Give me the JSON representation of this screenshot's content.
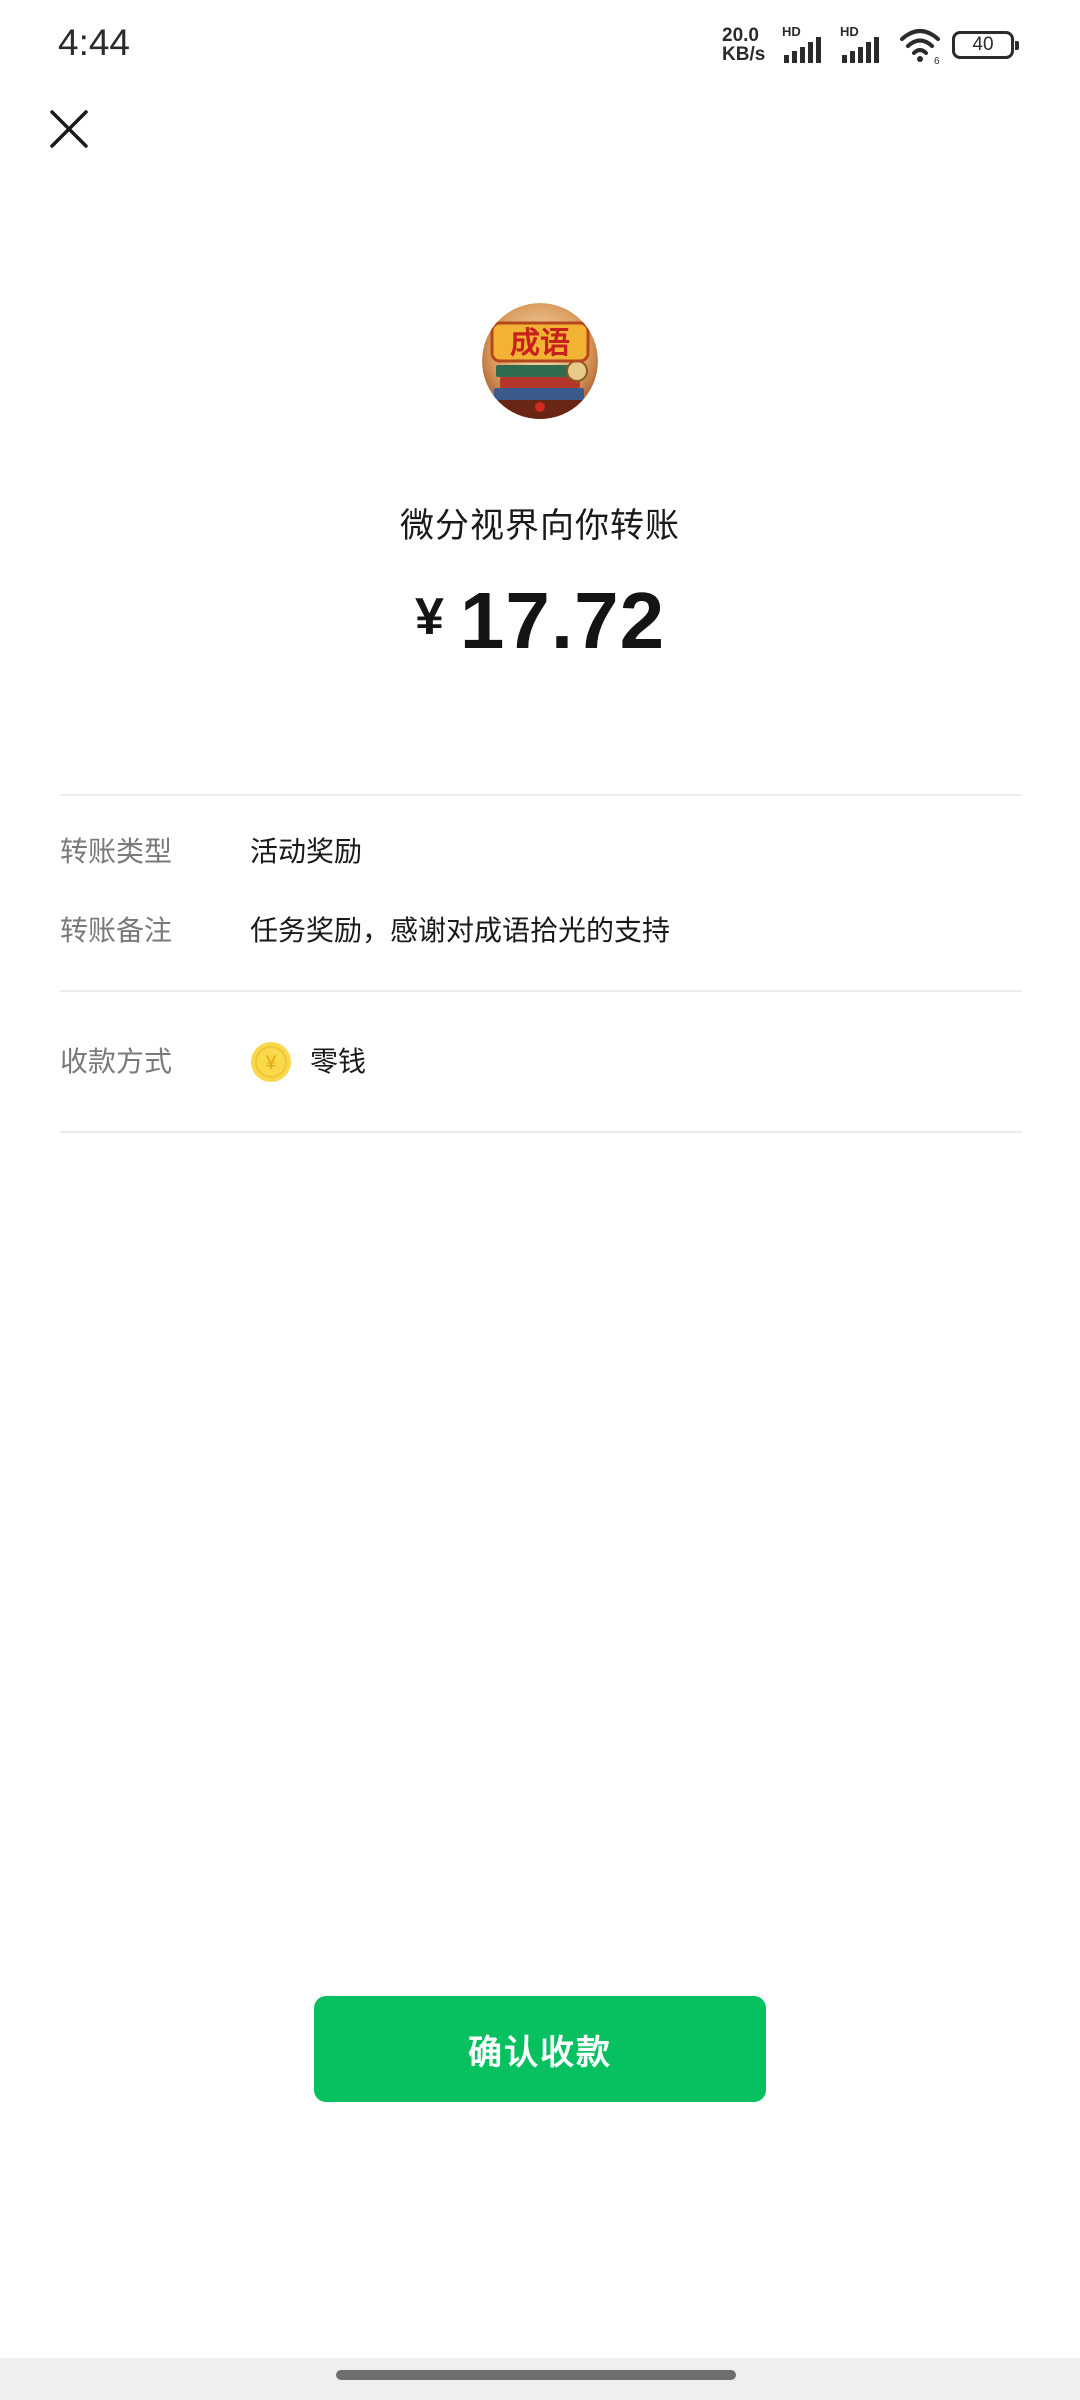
{
  "status_bar": {
    "time": "4:44",
    "net_speed_value": "20.0",
    "net_speed_unit": "KB/s",
    "sim1_label": "HD",
    "sim2_label": "HD",
    "wifi_icon": "wifi-icon",
    "battery_level": "40"
  },
  "header": {
    "close_icon": "close-icon"
  },
  "transfer": {
    "avatar_icon": "chengyu-avatar",
    "payer_text": "微分视界向你转账",
    "currency_symbol": "¥",
    "amount": "17.72"
  },
  "details": [
    {
      "label": "转账类型",
      "value": "活动奖励"
    },
    {
      "label": "转账备注",
      "value": "任务奖励，感谢对成语拾光的支持"
    }
  ],
  "receive": {
    "label": "收款方式",
    "coin_icon": "yuan-coin-icon",
    "value": "零钱"
  },
  "actions": {
    "confirm_label": "确认收款"
  },
  "colors": {
    "accent": "#07c160",
    "coin": "#f9d94a",
    "divider": "#ececec",
    "label_gray": "#7a7a7a"
  }
}
